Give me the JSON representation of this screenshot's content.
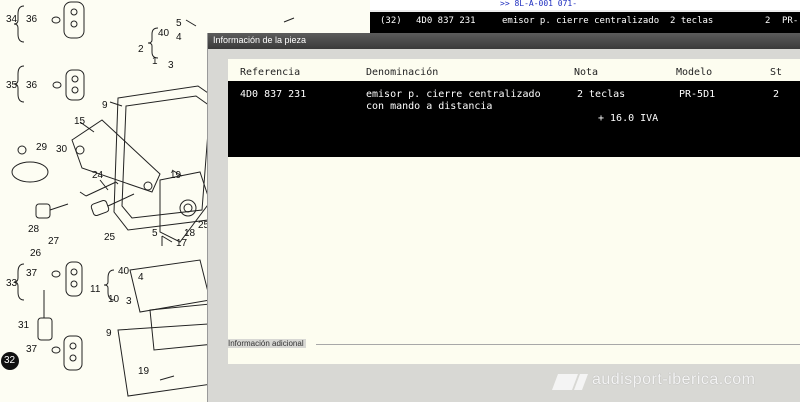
{
  "diagram": {
    "callouts": [
      "34",
      "36",
      "5",
      "4",
      "40",
      "2",
      "1",
      "3",
      "35",
      "36",
      "9",
      "15",
      "29",
      "30",
      "24",
      "28",
      "19",
      "25",
      "27",
      "26",
      "18",
      "17",
      "5",
      "25",
      "33",
      "37",
      "40",
      "4",
      "11",
      "10",
      "3",
      "31",
      "37",
      "9",
      "32",
      "19"
    ]
  },
  "background_list": {
    "ref_hint": ">> 8L-A-001 071-",
    "row": {
      "index": "(32)",
      "reference": "4D0 837 231",
      "description": "emisor p. cierre centralizado",
      "note": "2 teclas",
      "col": "2",
      "model": "PR-"
    }
  },
  "dialog": {
    "title": "Información de la pieza",
    "columns": {
      "reference": "Referencia",
      "description": "Denominación",
      "note": "Nota",
      "model": "Modelo",
      "st": "St"
    },
    "row": {
      "reference": "4D0 837 231",
      "description_line1": "emisor p. cierre centralizado",
      "description_line2": "con mando a distancia",
      "note": "2 teclas",
      "vat": "+ 16.0 IVA",
      "model": "PR-5D1",
      "st": "2"
    },
    "additional_info_label": "Información adicional"
  },
  "watermark": {
    "text": "audisport-iberica.com"
  }
}
